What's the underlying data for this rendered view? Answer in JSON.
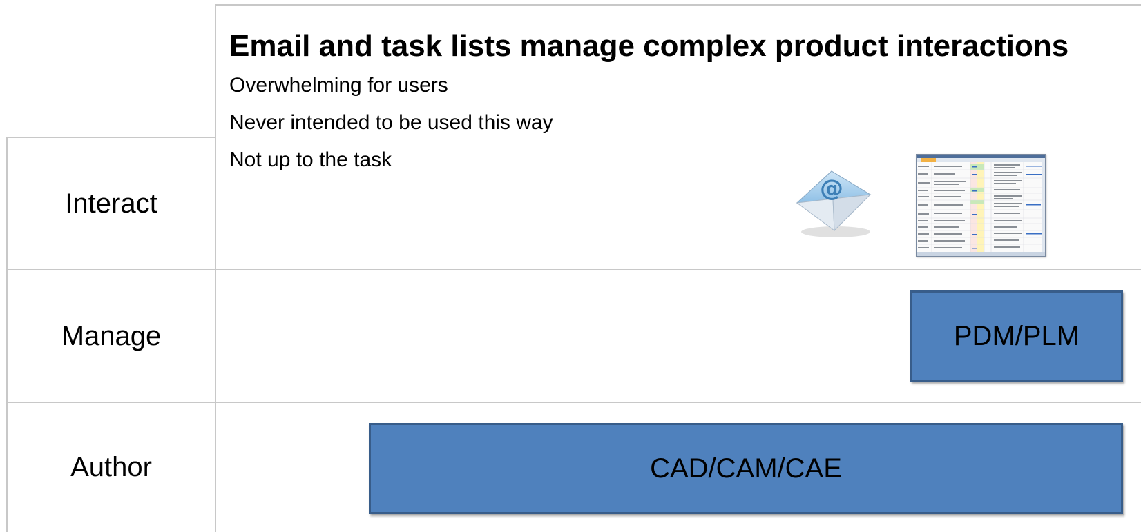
{
  "header": {
    "title": "Email and task lists manage complex product interactions",
    "bullets": [
      "Overwhelming  for users",
      "Never intended to be used this way",
      "Not up to the task"
    ]
  },
  "rows": [
    {
      "label": "Interact"
    },
    {
      "label": "Manage"
    },
    {
      "label": "Author"
    }
  ],
  "boxes": {
    "pdm": {
      "label": "PDM/PLM"
    },
    "cad": {
      "label": "CAD/CAM/CAE"
    }
  },
  "icons": {
    "envelope": "email-envelope-icon",
    "spreadsheet": "task-list-spreadsheet-icon"
  },
  "colors": {
    "box_fill": "#4f81bd",
    "box_border": "#385d8a",
    "grid_line": "#c8c8c8"
  }
}
